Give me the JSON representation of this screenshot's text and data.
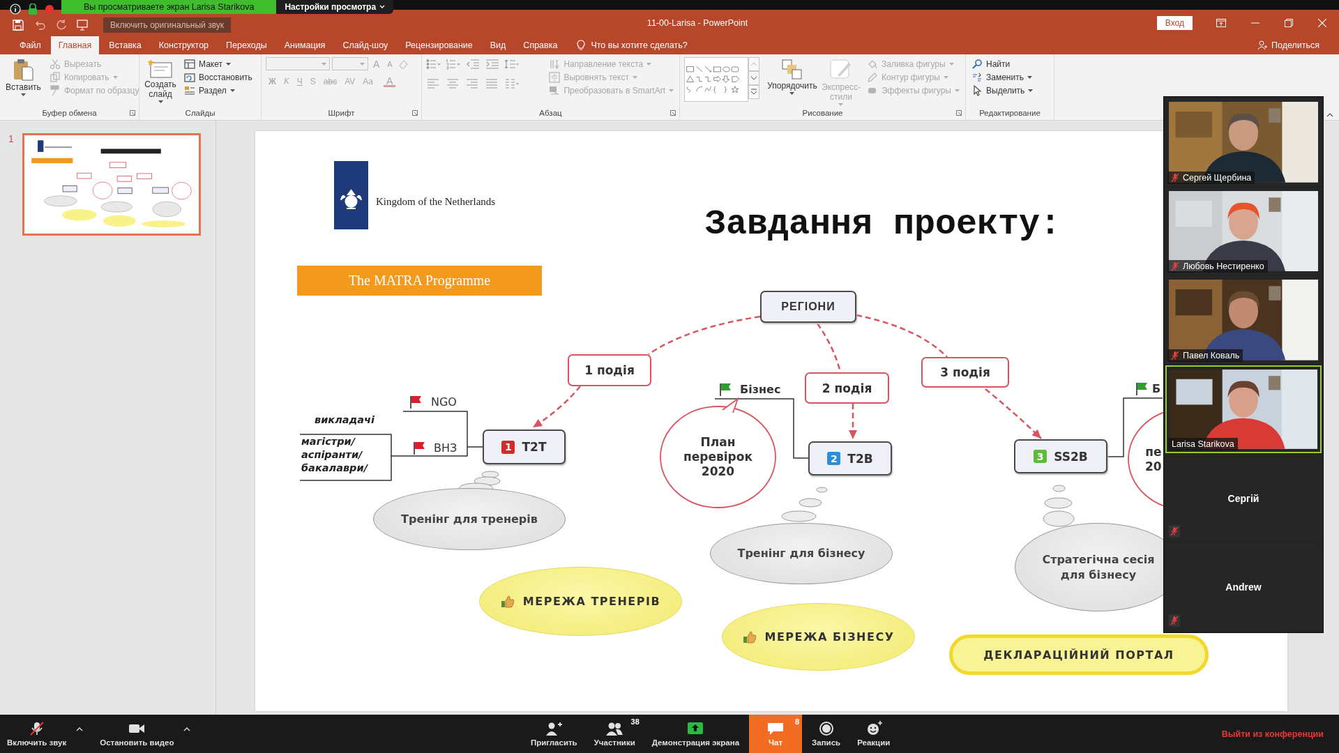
{
  "zoom_banner": {
    "viewing": "Вы просматриваете экран Larisa Starikova",
    "view_options": "Настройки просмотра",
    "original_sound": "Включить оригинальный звук"
  },
  "window": {
    "title": "11-00-Larisa  -  PowerPoint",
    "sign_in": "Вход"
  },
  "ribbon_tabs": [
    {
      "label": "Файл",
      "selected": false
    },
    {
      "label": "Главная",
      "selected": true
    },
    {
      "label": "Вставка",
      "selected": false
    },
    {
      "label": "Конструктор",
      "selected": false
    },
    {
      "label": "Переходы",
      "selected": false
    },
    {
      "label": "Анимация",
      "selected": false
    },
    {
      "label": "Слайд-шоу",
      "selected": false
    },
    {
      "label": "Рецензирование",
      "selected": false
    },
    {
      "label": "Вид",
      "selected": false
    },
    {
      "label": "Справка",
      "selected": false
    }
  ],
  "tell_me": "Что вы хотите сделать?",
  "share": "Поделиться",
  "clipboard": {
    "label": "Буфер обмена",
    "paste": "Вставить",
    "items": [
      {
        "label": "Вырезать",
        "kind": "cut",
        "disabled": true,
        "dropdown": false
      },
      {
        "label": "Копировать",
        "kind": "copy",
        "disabled": true,
        "dropdown": true
      },
      {
        "label": "Формат по образцу",
        "kind": "format-painter",
        "disabled": true,
        "dropdown": false
      }
    ]
  },
  "slides_group": {
    "label": "Слайды",
    "new_slide": "Создать слайд",
    "items": [
      {
        "label": "Макет",
        "kind": "layout",
        "disabled": false,
        "dropdown": true
      },
      {
        "label": "Восстановить",
        "kind": "reset",
        "disabled": false,
        "dropdown": false
      },
      {
        "label": "Раздел",
        "kind": "section",
        "disabled": false,
        "dropdown": true
      }
    ]
  },
  "font": {
    "label": "Шрифт",
    "disabled": true,
    "size_buttons": [
      "A",
      "A"
    ],
    "format_buttons": [
      "Ж",
      "К",
      "Ч",
      "S",
      "abc",
      "AV",
      "Aa"
    ],
    "color_button": "A"
  },
  "paragraph": {
    "label": "Абзац",
    "items": [
      {
        "label": "Направление текста",
        "kind": "text-direction",
        "disabled": true,
        "dropdown": true
      },
      {
        "label": "Выровнять текст",
        "kind": "align-text",
        "disabled": true,
        "dropdown": true
      },
      {
        "label": "Преобразовать в SmartArt",
        "kind": "smartart",
        "disabled": true,
        "dropdown": true
      }
    ]
  },
  "drawing": {
    "label": "Рисование",
    "arrange": "Упорядочить",
    "quick_styles": "Экспресс-стили",
    "quick_styles_disabled": true,
    "items": [
      {
        "label": "Заливка фигуры",
        "kind": "fill",
        "disabled": true,
        "dropdown": true
      },
      {
        "label": "Контур фигуры",
        "kind": "outline",
        "disabled": true,
        "dropdown": true
      },
      {
        "label": "Эффекты фигуры",
        "kind": "effects",
        "disabled": true,
        "dropdown": true
      }
    ]
  },
  "editing": {
    "label": "Редактирование",
    "items": [
      {
        "label": "Найти",
        "kind": "find",
        "disabled": false,
        "dropdown": false
      },
      {
        "label": "Заменить",
        "kind": "replace",
        "disabled": false,
        "dropdown": true
      },
      {
        "label": "Выделить",
        "kind": "select",
        "disabled": false,
        "dropdown": true
      }
    ]
  },
  "slide_thumbnails": [
    {
      "number": "1",
      "selected": true
    }
  ],
  "slide": {
    "logo_text": "Kingdom of the Netherlands",
    "programme": "The MATRA Programme",
    "title": "Завдання проекту:",
    "topics": [
      {
        "label": "РЕГІОНИ",
        "kind": "root"
      },
      {
        "label": "1 подія",
        "kind": "event"
      },
      {
        "label": "2 подія",
        "kind": "event"
      },
      {
        "label": "3 подія",
        "kind": "event"
      }
    ],
    "tasks": [
      {
        "label": "T2T",
        "badge": "1",
        "color": "#d42a2a"
      },
      {
        "label": "T2B",
        "badge": "2",
        "color": "#2a8fd8"
      },
      {
        "label": "SS2B",
        "badge": "3",
        "color": "#5dbb3a"
      }
    ],
    "flags": [
      {
        "label": "NGO",
        "color": "#d8202a"
      },
      {
        "label": "ВНЗ",
        "color": "#d8202a"
      },
      {
        "label": "Бізнес",
        "color": "#2f9e2f"
      },
      {
        "label": "Б",
        "color": "#2f9e2f"
      }
    ],
    "audience": [
      "викладачі",
      "магістри/\nаспіранти/\nбакалаври/"
    ],
    "callouts": [
      "План\nперевірок\n2020",
      "пе\n20"
    ],
    "thoughts": [
      "Тренінг для тренерів",
      "Тренінг для бізнесу",
      "Стратегічна сесія\nдля бізнесу"
    ],
    "outcomes": [
      {
        "label": "МЕРЕЖА ТРЕНЕРІВ",
        "kind": "ellipse"
      },
      {
        "label": "МЕРЕЖА БІЗНЕСУ",
        "kind": "ellipse"
      },
      {
        "label": "ДЕКЛАРАЦІЙНИЙ ПОРТАЛ",
        "kind": "pill"
      }
    ]
  },
  "participants": [
    {
      "name": "Сергей Щербина",
      "kind": "video",
      "muted": true,
      "speaking": false
    },
    {
      "name": "Любовь Нестиренко",
      "kind": "video",
      "muted": true,
      "speaking": false
    },
    {
      "name": "Павел Коваль",
      "kind": "video",
      "muted": true,
      "speaking": false
    },
    {
      "name": "Larisa Starikova",
      "kind": "video",
      "muted": false,
      "speaking": true
    },
    {
      "name": "Сергій",
      "kind": "avatar",
      "muted": true,
      "speaking": false
    },
    {
      "name": "Andrew",
      "kind": "avatar",
      "muted": true,
      "speaking": false
    }
  ],
  "meeting_controls": {
    "left": [
      {
        "label": "Включить звук",
        "kind": "mic-muted"
      },
      {
        "label": "Остановить видео",
        "kind": "camera"
      }
    ],
    "center": [
      {
        "label": "Пригласить",
        "kind": "invite",
        "selected": false
      },
      {
        "label": "Участники",
        "kind": "participants",
        "count": "38",
        "selected": false
      },
      {
        "label": "Демонстрация экрана",
        "kind": "share",
        "selected": false
      },
      {
        "label": "Чат",
        "kind": "chat",
        "count": "8",
        "selected": true
      },
      {
        "label": "Запись",
        "kind": "record",
        "selected": false
      },
      {
        "label": "Реакции",
        "kind": "reactions",
        "selected": false
      }
    ],
    "leave": "Выйти из конференции"
  }
}
